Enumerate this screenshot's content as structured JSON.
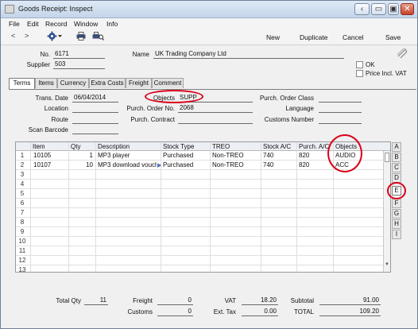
{
  "window": {
    "title": "Goods Receipt: Inspect",
    "controls": {
      "back": "‹",
      "restore": "▭",
      "maximize": "▣",
      "close": "✕"
    }
  },
  "menu": [
    "File",
    "Edit",
    "Record",
    "Window",
    "Info"
  ],
  "toolbar": {
    "nav_prev": "<",
    "nav_next": ">",
    "buttons": {
      "new": "New",
      "duplicate": "Duplicate",
      "cancel": "Cancel",
      "save": "Save"
    }
  },
  "header": {
    "no_label": "No.",
    "no_value": "6171",
    "supplier_label": "Supplier",
    "supplier_value": "503",
    "name_label": "Name",
    "name_value": "UK Trading Company Ltd",
    "ok_label": "OK",
    "price_incl_vat_label": "Price Incl. VAT"
  },
  "tabs": [
    "Terms",
    "Items",
    "Currency",
    "Extra Costs",
    "Freight",
    "Comment"
  ],
  "active_tab": "Terms",
  "terms": {
    "trans_date_label": "Trans. Date",
    "trans_date_value": "06/04/2014",
    "location_label": "Location",
    "location_value": "",
    "route_label": "Route",
    "route_value": "",
    "scan_barcode_label": "Scan Barcode",
    "scan_barcode_value": "",
    "objects_label": "Objects",
    "objects_value": "SUPP",
    "purch_order_no_label": "Purch. Order No.",
    "purch_order_no_value": "2068",
    "purch_contract_label": "Purch. Contract",
    "purch_contract_value": "",
    "purch_order_class_label": "Purch. Order Class",
    "purch_order_class_value": "",
    "language_label": "Language",
    "language_value": "",
    "customs_number_label": "Customs Number",
    "customs_number_value": ""
  },
  "grid": {
    "columns": [
      "Item",
      "Qty",
      "Description",
      "Stock Type",
      "TREO",
      "Stock A/C",
      "Purch. A/C",
      "Objects"
    ],
    "row_numbers": [
      "1",
      "2",
      "3",
      "4",
      "5",
      "6",
      "7",
      "8",
      "9",
      "10",
      "11",
      "12",
      "13"
    ],
    "rows": [
      {
        "item": "10105",
        "qty": "1",
        "description": "MP3 player",
        "stock_type": "Purchased",
        "treo": "Non-TREO",
        "stock_ac": "740",
        "purch_ac": "820",
        "objects": "AUDIO"
      },
      {
        "item": "10107",
        "qty": "10",
        "description": "MP3 download vouch",
        "stock_type": "Purchased",
        "treo": "Non-TREO",
        "stock_ac": "740",
        "purch_ac": "820",
        "objects": "ACC"
      }
    ],
    "side_tabs": [
      "A",
      "B",
      "C",
      "D",
      "E",
      "F",
      "G",
      "H",
      "I"
    ],
    "active_side_tab": "E"
  },
  "footer": {
    "total_qty_label": "Total Qty",
    "total_qty_value": "11",
    "freight_label": "Freight",
    "freight_value": "0",
    "customs_label": "Customs",
    "customs_value": "0",
    "vat_label": "VAT",
    "vat_value": "18.20",
    "ext_tax_label": "Ext. Tax",
    "ext_tax_value": "0.00",
    "subtotal_label": "Subtotal",
    "subtotal_value": "91.00",
    "total_label": "TOTAL",
    "total_value": "109.20"
  },
  "colors": {
    "highlight_circle": "#d8001a",
    "titlebar": "#c4d5ea"
  }
}
